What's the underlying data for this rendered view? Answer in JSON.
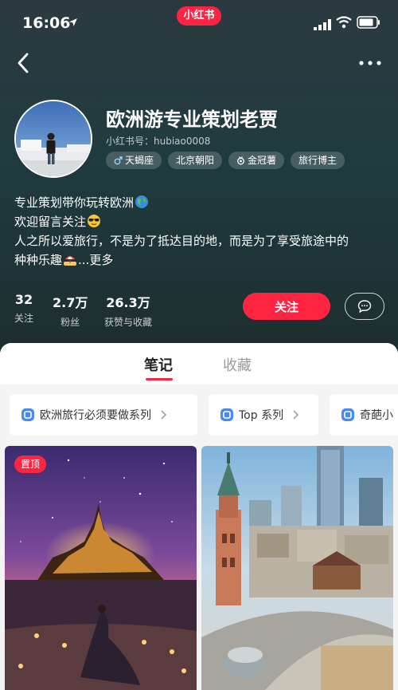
{
  "status_bar": {
    "time": "16:06"
  },
  "app_badge": "小红书",
  "profile": {
    "name": "欧洲游专业策划老贾",
    "xhs_id": "小红书号：hubiao0008",
    "tags": [
      {
        "label": "天蝎座",
        "icon": "male-symbol-icon"
      },
      {
        "label": "北京朝阳",
        "icon": ""
      },
      {
        "label": "金冠薯",
        "icon": "crown-medal-icon"
      },
      {
        "label": "旅行博主",
        "icon": ""
      }
    ],
    "bio": {
      "line1": "专业策划带你玩转欧洲",
      "line2": "欢迎留言关注",
      "line3": "人之所以爱旅行，不是为了抵达目的地，而是为了享受旅途中的",
      "line4": "种种乐趣",
      "more": "...更多"
    }
  },
  "stats": [
    {
      "value": "32",
      "label": "关注"
    },
    {
      "value": "2.7万",
      "label": "粉丝"
    },
    {
      "value": "26.3万",
      "label": "获赞与收藏"
    }
  ],
  "actions": {
    "follow": "关注"
  },
  "tabs": {
    "notes": "笔记",
    "collect": "收藏"
  },
  "series": [
    {
      "label": "欧洲旅行必须要做系列"
    },
    {
      "label": "Top 系列"
    },
    {
      "label": "奇葩小"
    }
  ],
  "pinned_label": "置顶",
  "colors": {
    "accent": "#ff2442",
    "header_bg": "#1f3b3f"
  }
}
